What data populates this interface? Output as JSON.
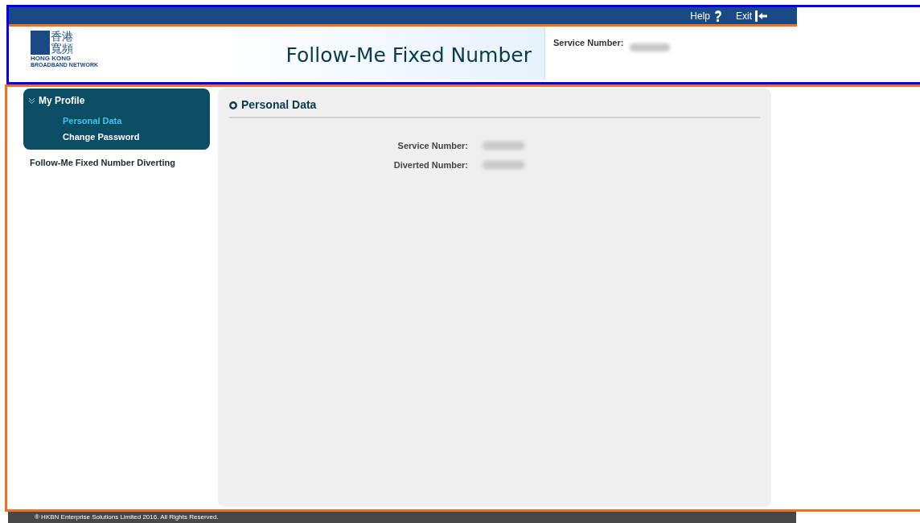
{
  "top_bar": {
    "links": [
      {
        "label": "Help",
        "kind": "help"
      },
      {
        "label": "Exit",
        "kind": "exit"
      }
    ]
  },
  "header": {
    "logo": {
      "chinese": "香港寬頻",
      "english": "HONG KONG",
      "tagline": "BROADBAND NETWORK"
    },
    "title": "Follow-Me Fixed Number",
    "service_label": "Service Number:"
  },
  "sidebar": {
    "groups": [
      {
        "label": "My Profile",
        "expanded": true,
        "children": [
          {
            "label": "Personal Data",
            "selected": true
          },
          {
            "label": "Change Password",
            "selected": false
          }
        ]
      },
      {
        "label": "Follow-Me Fixed Number Diverting",
        "expanded": false
      }
    ]
  },
  "panel": {
    "title": "Personal Data",
    "fields": [
      {
        "label": "Service Number:"
      },
      {
        "label": "Diverted Number:"
      }
    ]
  },
  "footer": "® HKBN Enterprise Solutions Limited 2016. All Rights Reserved."
}
